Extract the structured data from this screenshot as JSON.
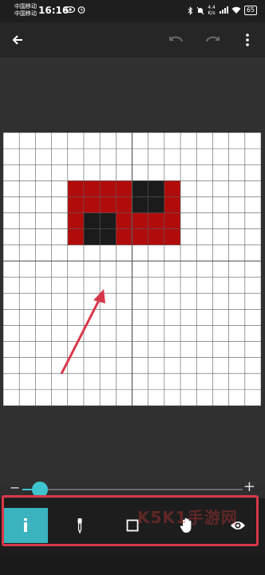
{
  "status_bar": {
    "carrier_1": "中国移动",
    "carrier_2": "中国移动",
    "time": "16:16",
    "net_speed_value": "4.4",
    "net_speed_unit": "K/s",
    "battery": "65"
  },
  "app_bar": {
    "back_icon": "arrow-left-icon",
    "undo_icon": "undo-icon",
    "redo_icon": "redo-icon",
    "menu_icon": "more-vert-icon"
  },
  "canvas": {
    "cols": 16,
    "rows": 17,
    "colors": {
      "grid_bg": "#ffffff",
      "grid_line": "#5a5a5a",
      "red": "#b10c0c",
      "black": "#1b1b1b"
    },
    "cells": [
      {
        "r": 3,
        "c": 4,
        "color": "red"
      },
      {
        "r": 3,
        "c": 5,
        "color": "red"
      },
      {
        "r": 3,
        "c": 6,
        "color": "red"
      },
      {
        "r": 3,
        "c": 7,
        "color": "red"
      },
      {
        "r": 3,
        "c": 8,
        "color": "black"
      },
      {
        "r": 3,
        "c": 9,
        "color": "black"
      },
      {
        "r": 3,
        "c": 10,
        "color": "red"
      },
      {
        "r": 4,
        "c": 4,
        "color": "red"
      },
      {
        "r": 4,
        "c": 5,
        "color": "red"
      },
      {
        "r": 4,
        "c": 6,
        "color": "red"
      },
      {
        "r": 4,
        "c": 7,
        "color": "red"
      },
      {
        "r": 4,
        "c": 8,
        "color": "black"
      },
      {
        "r": 4,
        "c": 9,
        "color": "black"
      },
      {
        "r": 4,
        "c": 10,
        "color": "red"
      },
      {
        "r": 5,
        "c": 4,
        "color": "red"
      },
      {
        "r": 5,
        "c": 5,
        "color": "black"
      },
      {
        "r": 5,
        "c": 6,
        "color": "black"
      },
      {
        "r": 5,
        "c": 7,
        "color": "red"
      },
      {
        "r": 5,
        "c": 8,
        "color": "red"
      },
      {
        "r": 5,
        "c": 9,
        "color": "red"
      },
      {
        "r": 5,
        "c": 10,
        "color": "red"
      },
      {
        "r": 6,
        "c": 4,
        "color": "red"
      },
      {
        "r": 6,
        "c": 5,
        "color": "black"
      },
      {
        "r": 6,
        "c": 6,
        "color": "black"
      },
      {
        "r": 6,
        "c": 7,
        "color": "red"
      },
      {
        "r": 6,
        "c": 8,
        "color": "red"
      },
      {
        "r": 6,
        "c": 9,
        "color": "red"
      },
      {
        "r": 6,
        "c": 10,
        "color": "red"
      }
    ]
  },
  "zoom": {
    "minus_label": "−",
    "plus_label": "+",
    "level": 0.05,
    "accent": "#3ec4cf"
  },
  "toolbar": {
    "accent": "#3ab3bf",
    "tools": [
      {
        "name": "pencil-icon",
        "active": true
      },
      {
        "name": "eyedropper-icon",
        "active": false
      },
      {
        "name": "square-icon",
        "active": false
      },
      {
        "name": "hand-icon",
        "active": false
      },
      {
        "name": "eye-icon",
        "active": false
      }
    ]
  },
  "watermark": "K5K1手游网"
}
